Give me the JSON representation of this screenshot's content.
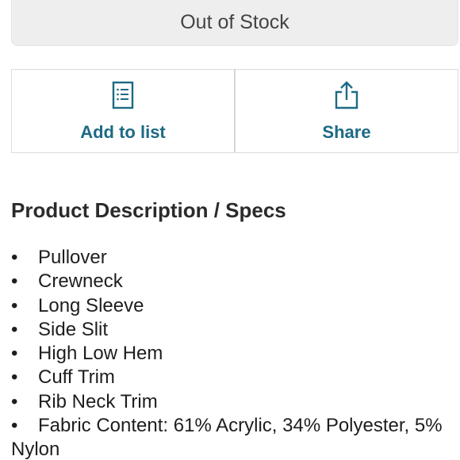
{
  "stock_button": {
    "label": "Out of Stock"
  },
  "actions": {
    "add_to_list": {
      "label": "Add to list",
      "icon": "list-icon"
    },
    "share": {
      "label": "Share",
      "icon": "share-icon"
    }
  },
  "description": {
    "title": "Product Description / Specs",
    "items": [
      "Pullover",
      "Crewneck",
      "Long Sleeve",
      "Side Slit",
      "High Low Hem",
      "Cuff Trim",
      "Rib Neck Trim",
      "Fabric Content: 61% Acrylic, 34% Polyester, 5% Nylon"
    ]
  },
  "colors": {
    "accent": "#1c6a84",
    "button_bg": "#eeeeee",
    "border": "#dcdcdc"
  }
}
